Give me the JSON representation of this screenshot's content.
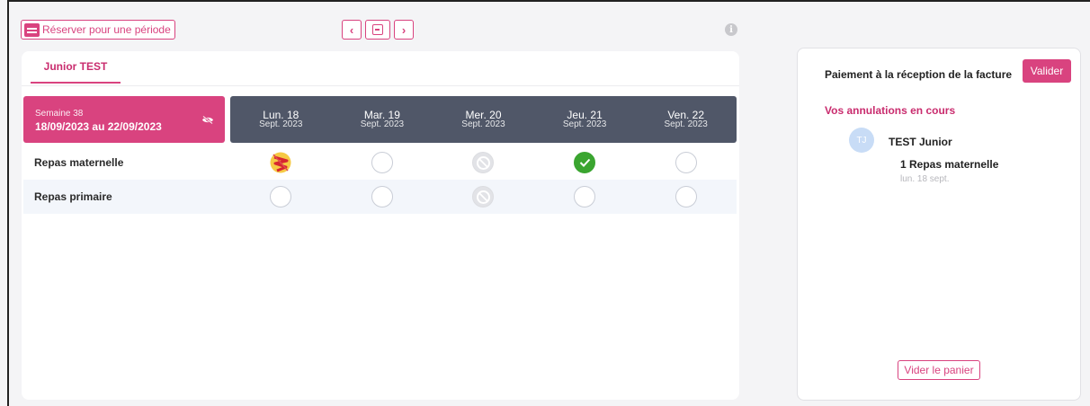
{
  "toolbar": {
    "reserve_label": "Réserver pour une période",
    "prev_symbol": "‹",
    "next_symbol": "›",
    "calendar_icon": "calendar-icon",
    "info_symbol": "i"
  },
  "tab": {
    "label": "Junior TEST"
  },
  "week": {
    "label": "Semaine 38",
    "range": "18/09/2023 au 22/09/2023",
    "hide_icon": "eye-slash-icon"
  },
  "days": [
    {
      "day": "Lun. 18",
      "month": "Sept. 2023"
    },
    {
      "day": "Mar. 19",
      "month": "Sept. 2023"
    },
    {
      "day": "Mer. 20",
      "month": "Sept. 2023"
    },
    {
      "day": "Jeu. 21",
      "month": "Sept. 2023"
    },
    {
      "day": "Ven. 22",
      "month": "Sept. 2023"
    }
  ],
  "rows": [
    {
      "label": "Repas maternelle",
      "states": [
        "cancel-pending",
        "empty",
        "disabled",
        "checked",
        "empty"
      ]
    },
    {
      "label": "Repas primaire",
      "states": [
        "empty",
        "empty",
        "disabled",
        "empty",
        "empty"
      ]
    }
  ],
  "side": {
    "payment_title": "Paiement à la réception de la facture",
    "validate_label": "Valider",
    "cancellations_title": "Vos annulations en cours",
    "avatar_initials": "TJ",
    "child_name": "TEST Junior",
    "meal_line": "1 Repas maternelle",
    "meal_date": "lun. 18 sept.",
    "empty_cart_label": "Vider le panier"
  },
  "colors": {
    "accent": "#d9437f",
    "header_dark": "#505768",
    "checked_green": "#3aa530"
  }
}
